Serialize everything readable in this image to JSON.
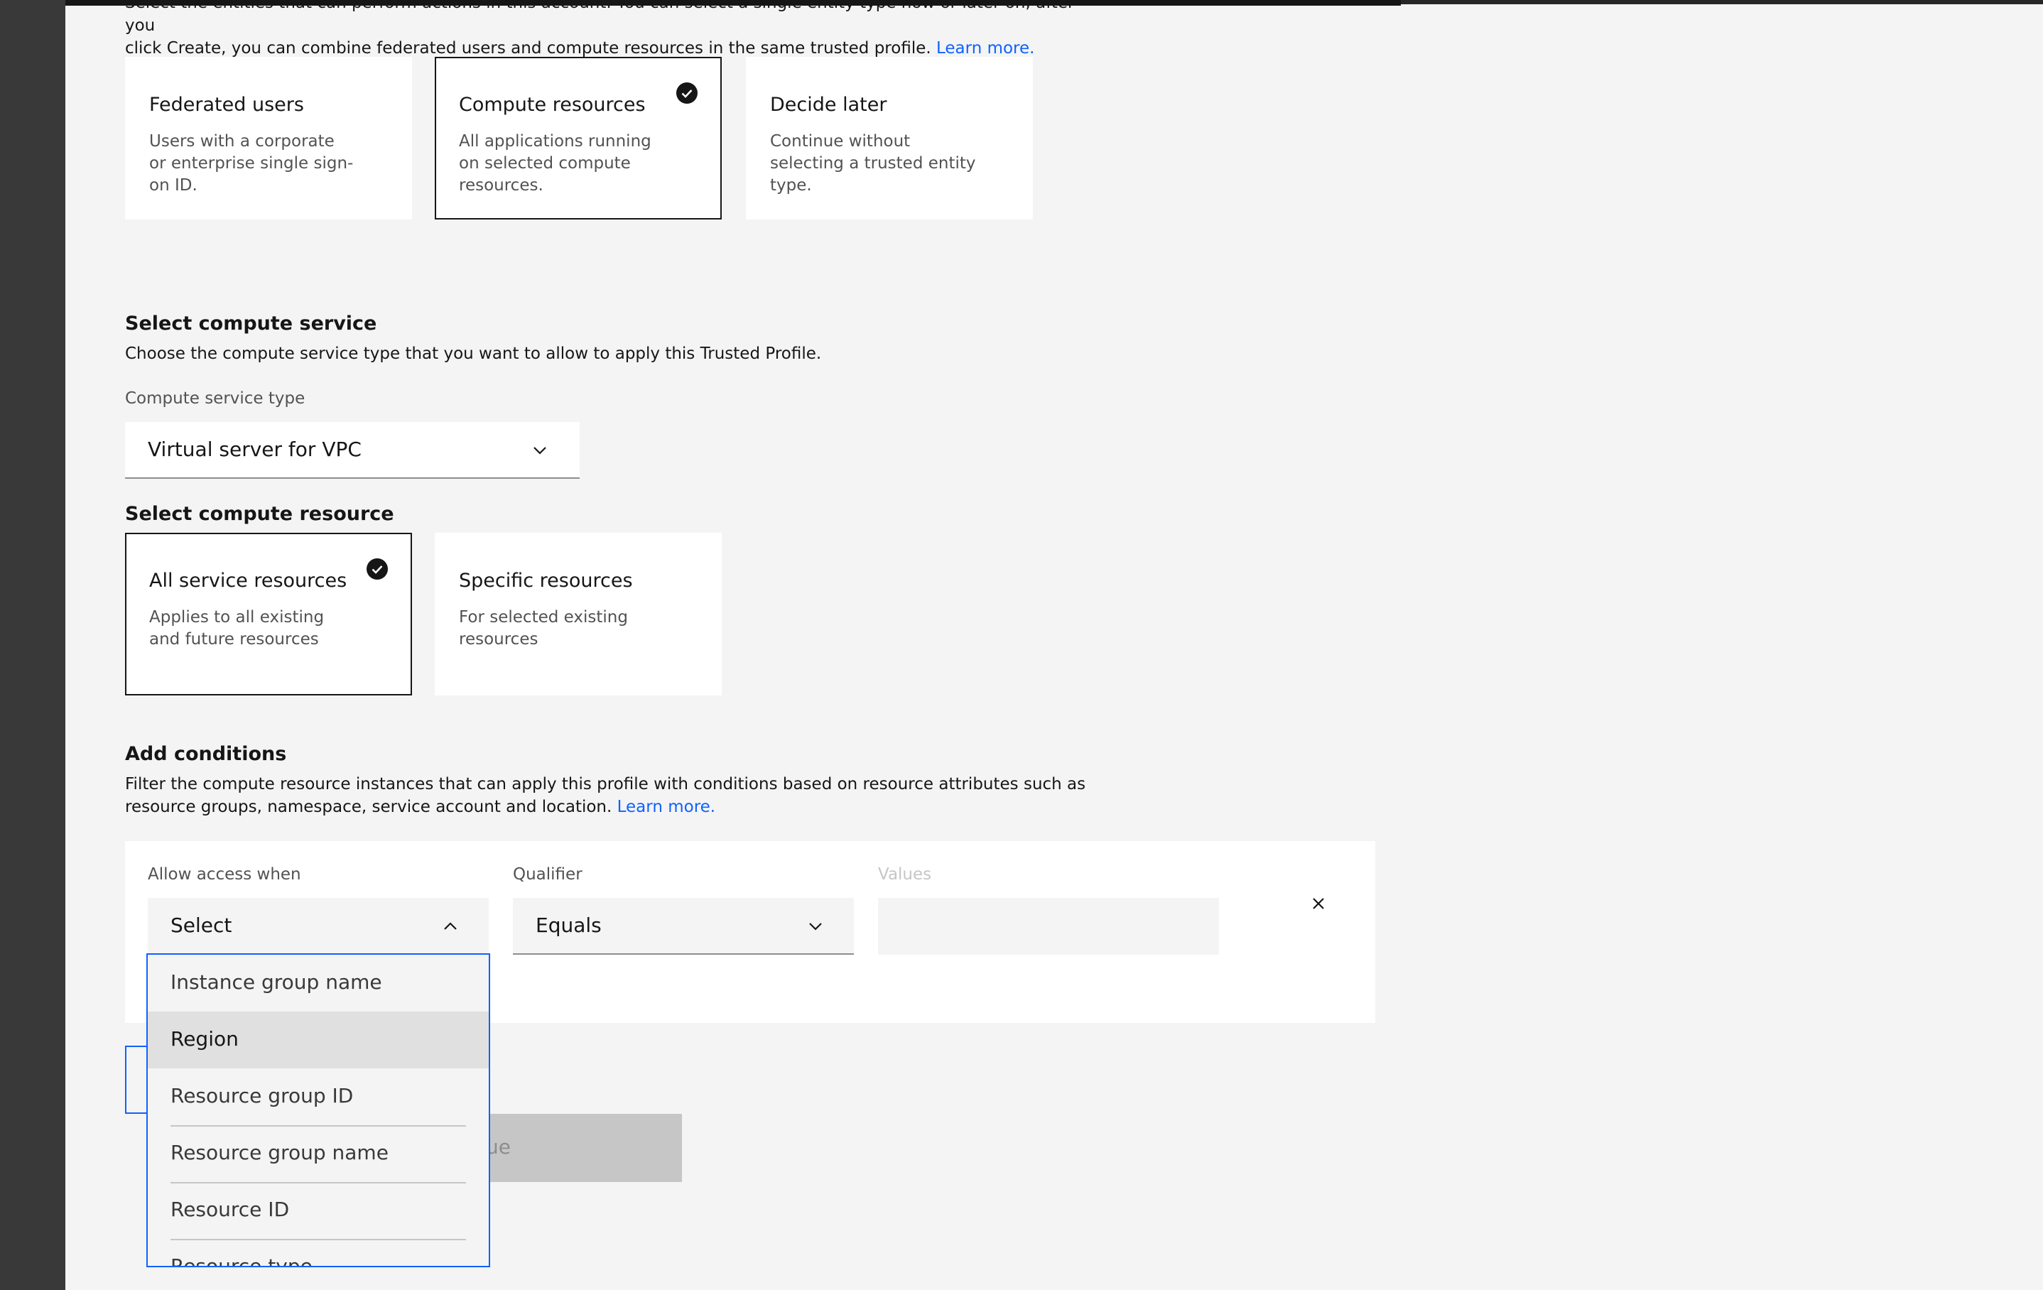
{
  "intro": {
    "line1": "Select the entities that can perform actions in this account. You can select a single entity type now or later on, after you",
    "line2": "click Create, you can combine federated users and compute resources in the same trusted profile.",
    "link": "Learn more."
  },
  "entity_tiles": [
    {
      "title": "Federated users",
      "description": "Users with a corporate or enterprise single sign-on ID.",
      "selected": false
    },
    {
      "title": "Compute resources",
      "description": "All applications running on selected compute resources.",
      "selected": true
    },
    {
      "title": "Decide later",
      "description": "Continue without selecting a trusted entity type.",
      "selected": false
    }
  ],
  "compute_service": {
    "heading": "Select compute service",
    "helper": "Choose the compute service type that you want to allow to apply this Trusted Profile.",
    "field_label": "Compute service type",
    "value": "Virtual server for VPC"
  },
  "compute_resource": {
    "heading": "Select compute resource",
    "tiles": [
      {
        "title": "All service resources",
        "description": "Applies to all existing and future resources",
        "selected": true
      },
      {
        "title": "Specific resources",
        "description": "For selected existing resources",
        "selected": false
      }
    ]
  },
  "conditions": {
    "heading": "Add conditions",
    "helper_line1": "Filter the compute resource instances that can apply this profile with conditions based on resource attributes such as",
    "helper_line2": "resource groups, namespace, service account and location.",
    "link": "Learn more.",
    "allow_label": "Allow access when",
    "allow_value": "Select",
    "qualifier_label": "Qualifier",
    "qualifier_value": "Equals",
    "values_label": "Values",
    "options": [
      "Instance group name",
      "Region",
      "Resource group ID",
      "Resource group name",
      "Resource ID",
      "Resource type"
    ],
    "hovered_option": "Region",
    "hidden_button_fragment": "ue"
  },
  "colors": {
    "accent": "#0f62fe",
    "selected_border": "#161616",
    "page_bg": "#f4f4f4"
  },
  "icons": [
    "checkmark-filled-icon",
    "chevron-down-icon",
    "chevron-up-icon",
    "close-icon"
  ]
}
